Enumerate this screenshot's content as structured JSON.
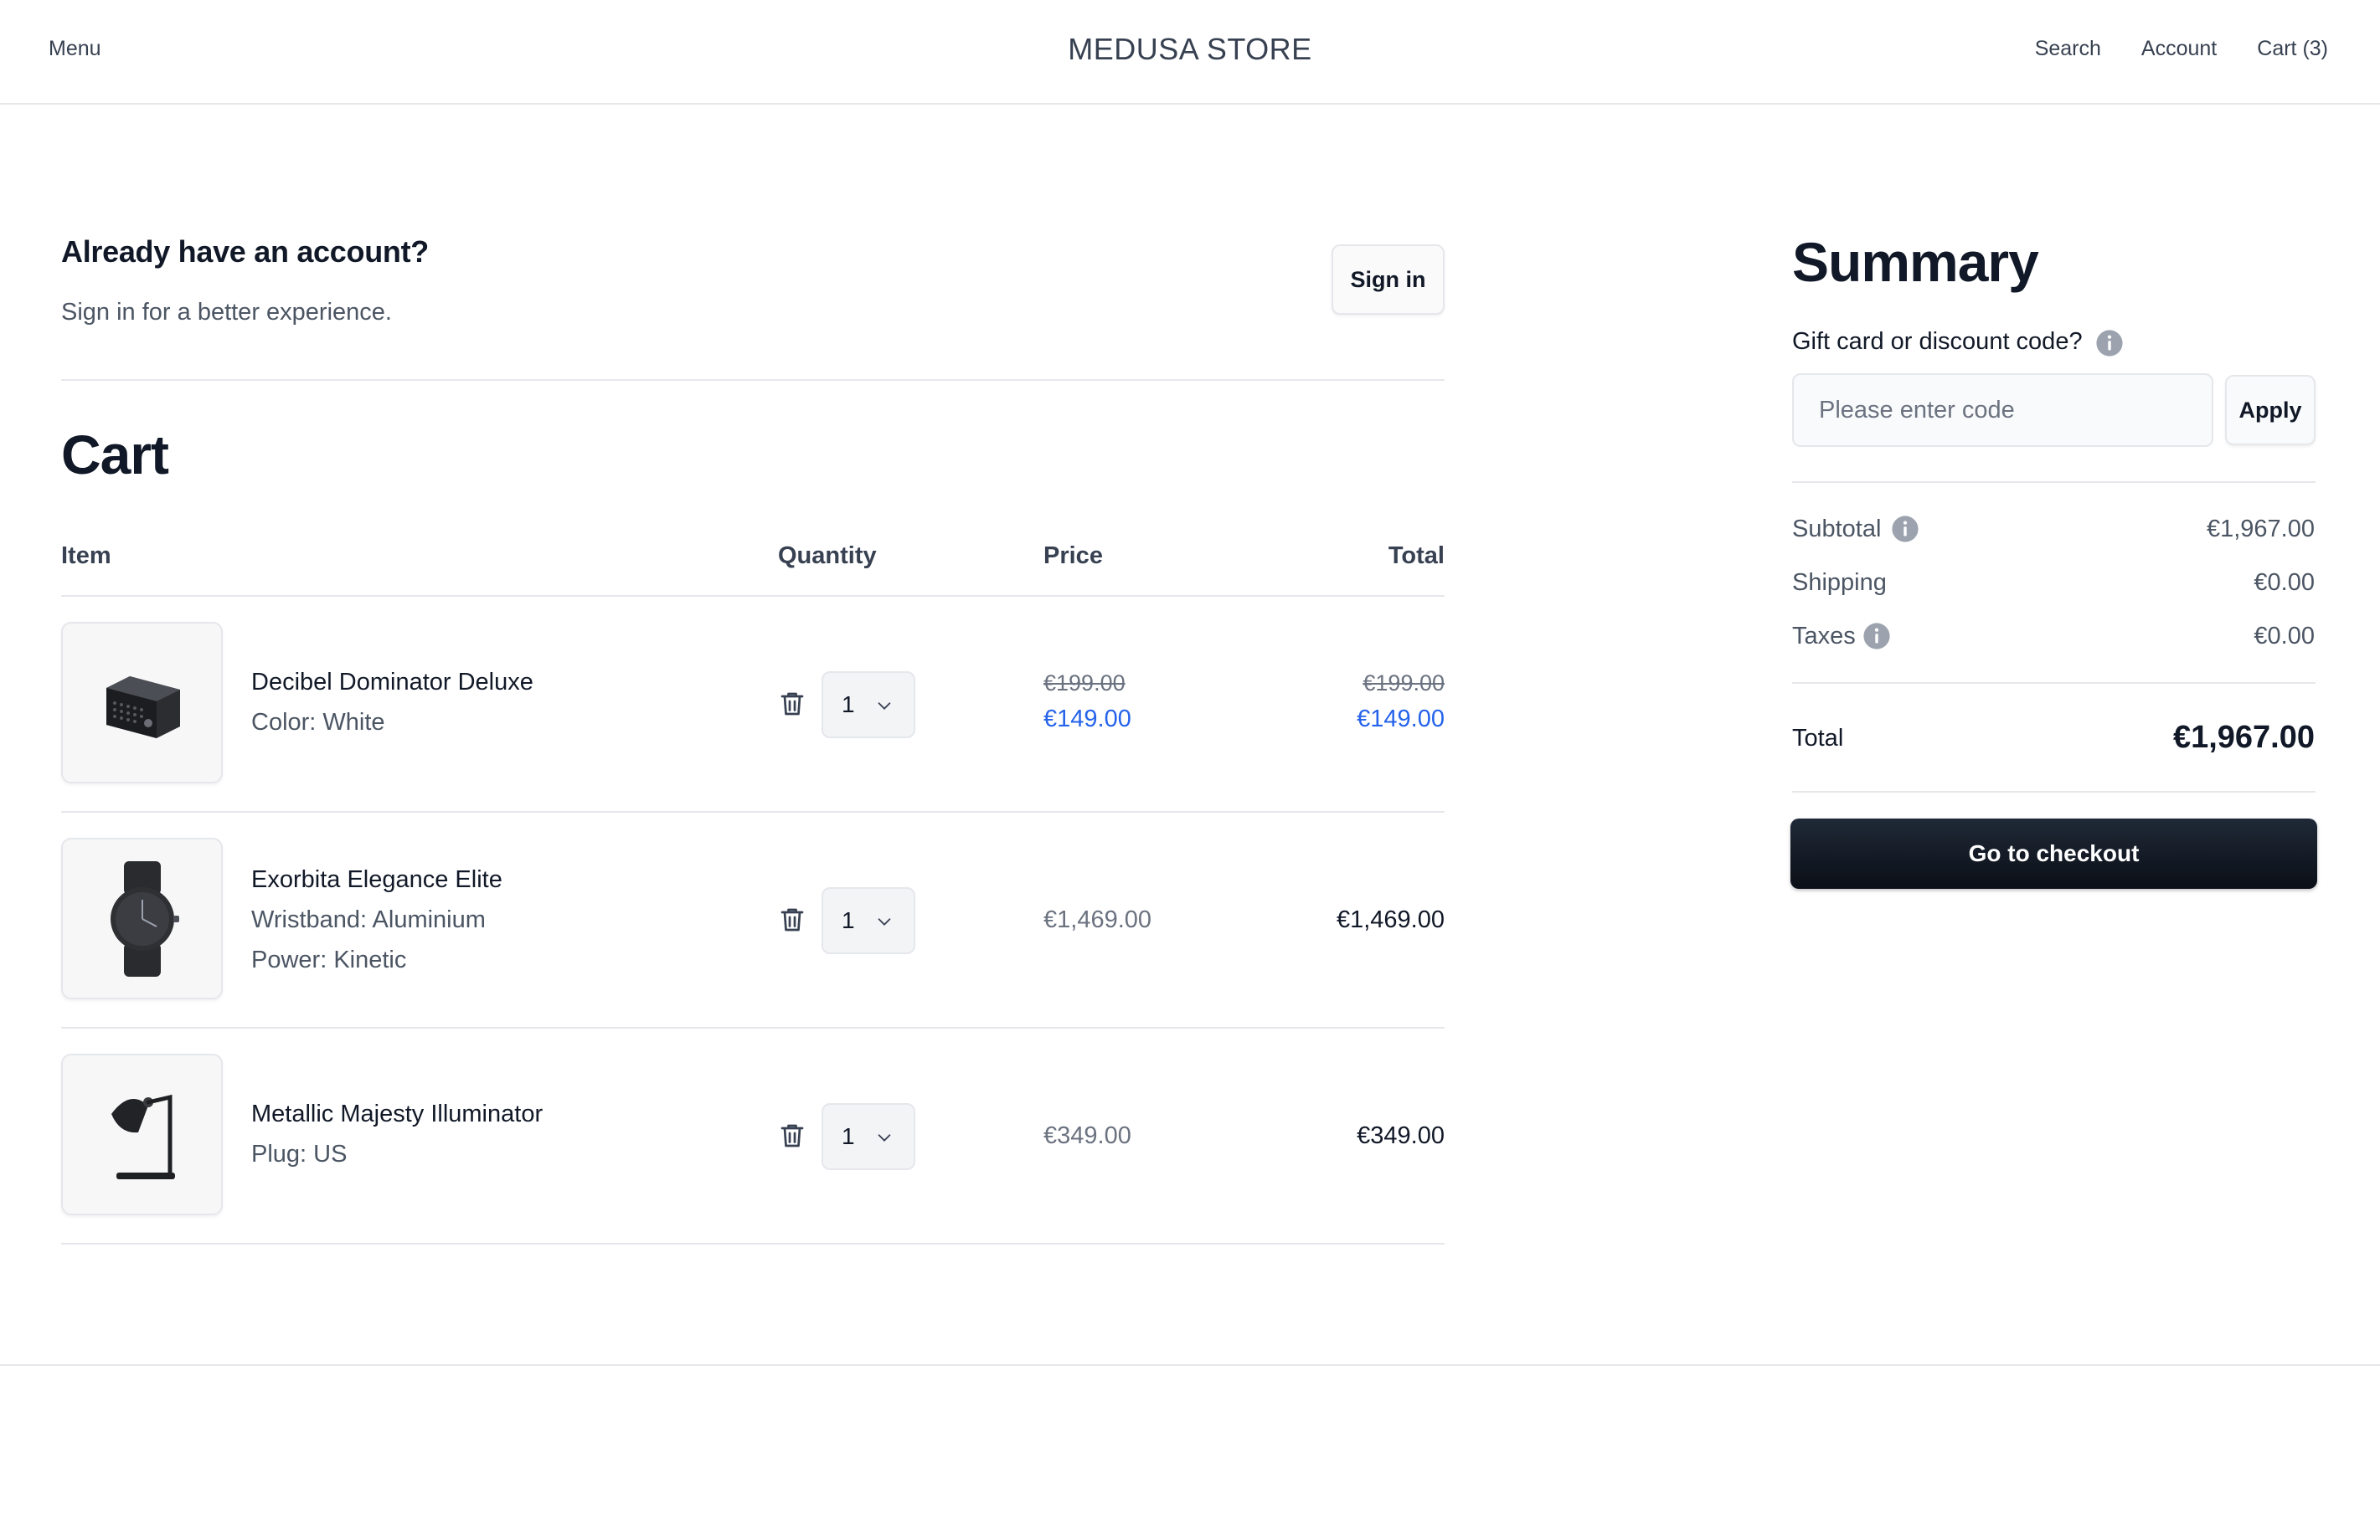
{
  "header": {
    "menu_label": "Menu",
    "store_name": "MEDUSA STORE",
    "search_label": "Search",
    "account_label": "Account",
    "cart_label": "Cart (3)"
  },
  "signin": {
    "title": "Already have an account?",
    "subtitle": "Sign in for a better experience.",
    "button_label": "Sign in"
  },
  "cart": {
    "title": "Cart",
    "columns": {
      "item": "Item",
      "quantity": "Quantity",
      "price": "Price",
      "total": "Total"
    },
    "items": [
      {
        "name": "Decibel Dominator Deluxe",
        "variants": [
          "Color: White"
        ],
        "quantity": "1",
        "original_price": "€199.00",
        "price": "€149.00",
        "original_total": "€199.00",
        "total": "€149.00",
        "on_sale": true,
        "icon": "speaker-image"
      },
      {
        "name": "Exorbita Elegance Elite",
        "variants": [
          "Wristband: Aluminium",
          "Power: Kinetic"
        ],
        "quantity": "1",
        "price": "€1,469.00",
        "total": "€1,469.00",
        "on_sale": false,
        "icon": "watch-image"
      },
      {
        "name": "Metallic Majesty Illuminator",
        "variants": [
          "Plug: US"
        ],
        "quantity": "1",
        "price": "€349.00",
        "total": "€349.00",
        "on_sale": false,
        "icon": "lamp-image"
      }
    ]
  },
  "summary": {
    "title": "Summary",
    "gift_label": "Gift card or discount code?",
    "code_placeholder": "Please enter code",
    "code_value": "",
    "apply_label": "Apply",
    "subtotal_label": "Subtotal",
    "subtotal_value": "€1,967.00",
    "shipping_label": "Shipping",
    "shipping_value": "€0.00",
    "taxes_label": "Taxes",
    "taxes_value": "€0.00",
    "total_label": "Total",
    "total_value": "€1,967.00",
    "checkout_label": "Go to checkout"
  },
  "colors": {
    "sale_price": "#2563eb",
    "checkout_button": "#0b0f17",
    "divider": "#e5e7eb"
  }
}
